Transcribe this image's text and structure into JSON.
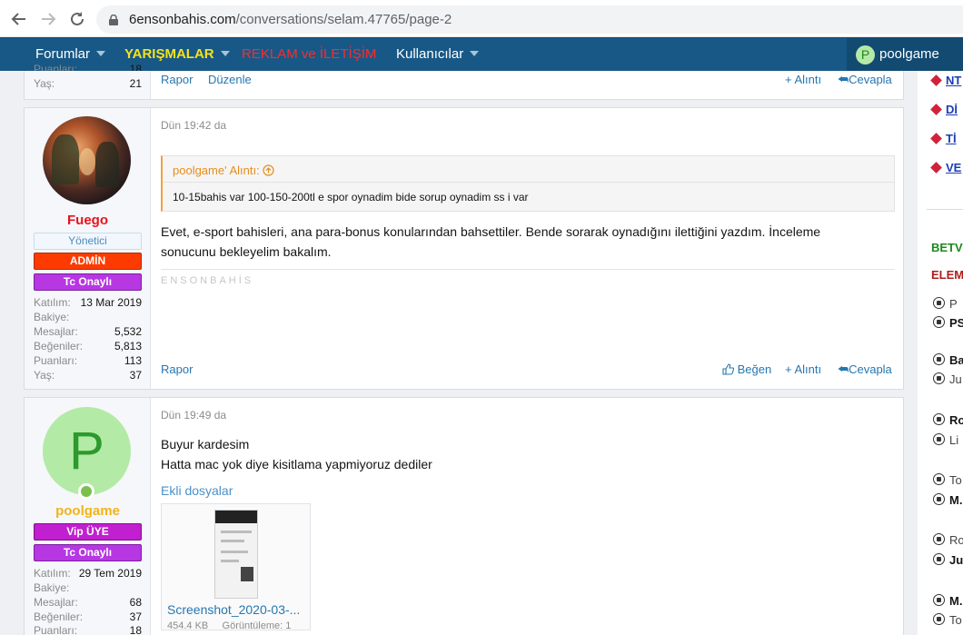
{
  "browser": {
    "url_domain": "6ensonbahis.com",
    "url_path": "/conversations/selam.47765/page-2",
    "back_icon": "arrow-left-icon",
    "forward_icon": "arrow-right-icon",
    "reload_icon": "reload-icon"
  },
  "nav": {
    "forumlar": "Forumlar",
    "yarismalar": "YARIŞMALAR",
    "reklam": "REKLAM ve İLETİŞİM",
    "kullanicilar": "Kullanıcılar",
    "user_initial": "P",
    "username": "poolgame",
    "yarismalar_color": "#f7e21b",
    "reklam_color": "#ff2a2a"
  },
  "post0": {
    "stat_partial_label": "Puanları:",
    "stat_partial_value": "18",
    "yas_label": "Yaş:",
    "yas_value": "21",
    "rapor": "Rapor",
    "duzenle": "Düzenle",
    "alinti": "+ Alıntı",
    "cevapla": "Cevapla"
  },
  "post1": {
    "username": "Fuego",
    "username_color": "#e8121c",
    "badge_yonetici": "Yönetici",
    "badge_admin": "ADMİN",
    "badge_tc": "Tc Onaylı",
    "stats": [
      {
        "label": "Katılım:",
        "value": "13 Mar 2019"
      },
      {
        "label": "Bakiye:",
        "value": ""
      },
      {
        "label": "Mesajlar:",
        "value": "5,532"
      },
      {
        "label": "Beğeniler:",
        "value": "5,813"
      },
      {
        "label": "Puanları:",
        "value": "113"
      },
      {
        "label": "Yaş:",
        "value": "37"
      }
    ],
    "date": "Dün 19:42 da",
    "quote_head": "poolgame' Alıntı:",
    "quote_body": "10-15bahis var 100-150-200tl e spor oynadim bide sorup oynadim ss i var",
    "text_line1": "Evet, e-sport bahisleri, ana para-bonus konularından bahsettiler. Bende sorarak oynadığını ilettiğini yazdım. İnceleme",
    "text_line2": "sonucunu bekleyelim bakalım.",
    "signature": "ENSONBAHİS",
    "rapor": "Rapor",
    "begen": "Beğen",
    "alinti": "+ Alıntı",
    "cevapla": "Cevapla"
  },
  "post2": {
    "avatar_letter": "P",
    "username": "poolgame",
    "username_color": "#f3b414",
    "badge_vip": "Vip ÜYE",
    "badge_tc": "Tc Onaylı",
    "stats": [
      {
        "label": "Katılım:",
        "value": "29 Tem 2019"
      },
      {
        "label": "Bakiye:",
        "value": ""
      },
      {
        "label": "Mesajlar:",
        "value": "68"
      },
      {
        "label": "Beğeniler:",
        "value": "37"
      },
      {
        "label": "Puanları:",
        "value": "18"
      }
    ],
    "date": "Dün 19:49 da",
    "text_line1": "Buyur kardesim",
    "text_line2": "Hatta mac yok diye kisitlama yapmiyoruz dediler",
    "attach_title": "Ekli dosyalar",
    "attach_name": "Screenshot_2020-03-...",
    "attach_size": "454.4 KB",
    "attach_views": "Görüntüleme: 1"
  },
  "sidebar": {
    "links": [
      "NT",
      "Dİ",
      "Tİ",
      "VE"
    ],
    "head1": "BETV",
    "head1_color": "#1a8a1a",
    "head2": "ELEM",
    "head2_color": "#b01c1c",
    "teams": [
      "P",
      "PS",
      "Ba",
      "Ju",
      "Ro",
      "Li",
      "To",
      "M.",
      "Ro",
      "Ju",
      "M.",
      "To"
    ]
  }
}
